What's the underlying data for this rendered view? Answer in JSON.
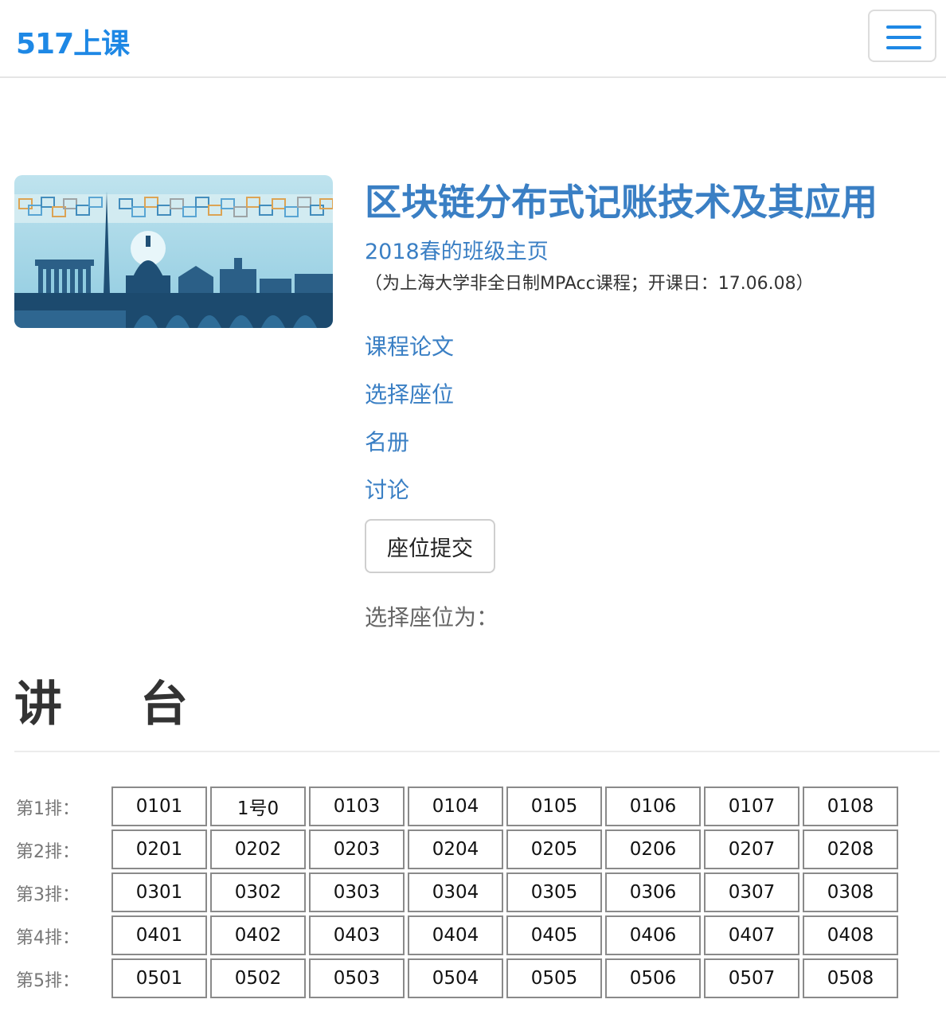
{
  "header": {
    "brand": "517上课",
    "menu_icon": "hamburger-menu-icon",
    "accent_color": "#1e88e5"
  },
  "course": {
    "image_label": "course-cover-illustration",
    "title": "区块链分布式记账技术及其应用",
    "class_page": "2018春的班级主页",
    "note": "（为上海大学非全日制MPAcc课程；开课日：17.06.08）",
    "links": [
      "课程论文",
      "选择座位",
      "名册",
      "讨论"
    ],
    "submit_label": "座位提交",
    "selected_label": "选择座位为：",
    "link_color": "#3a7fc4"
  },
  "podium": {
    "char1": "讲",
    "char2": "台"
  },
  "seats": {
    "rows": [
      {
        "label": "第1排：",
        "seats": [
          "0101",
          "1号0",
          "0103",
          "0104",
          "0105",
          "0106",
          "0107",
          "0108"
        ]
      },
      {
        "label": "第2排：",
        "seats": [
          "0201",
          "0202",
          "0203",
          "0204",
          "0205",
          "0206",
          "0207",
          "0208"
        ]
      },
      {
        "label": "第3排：",
        "seats": [
          "0301",
          "0302",
          "0303",
          "0304",
          "0305",
          "0306",
          "0307",
          "0308"
        ]
      },
      {
        "label": "第4排：",
        "seats": [
          "0401",
          "0402",
          "0403",
          "0404",
          "0405",
          "0406",
          "0407",
          "0408"
        ]
      },
      {
        "label": "第5排：",
        "seats": [
          "0501",
          "0502",
          "0503",
          "0504",
          "0505",
          "0506",
          "0507",
          "0508"
        ]
      }
    ]
  }
}
